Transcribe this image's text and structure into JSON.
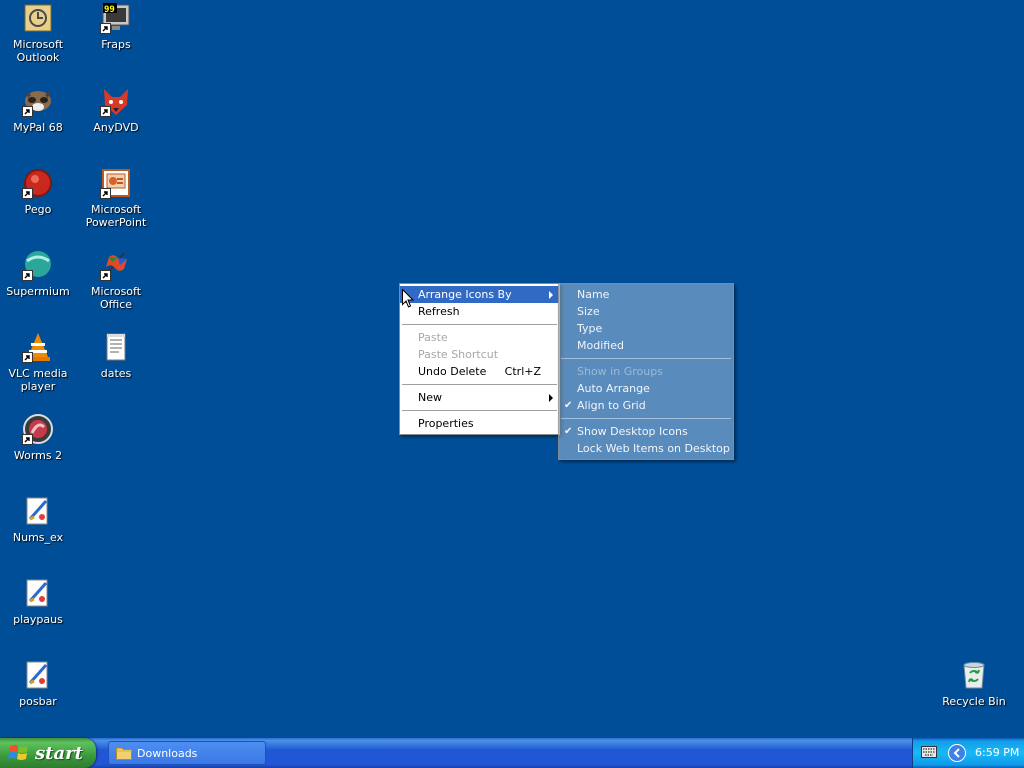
{
  "desktop": {
    "icons": [
      {
        "label": "Microsoft Outlook",
        "icon": "outlook-icon"
      },
      {
        "label": "Fraps",
        "icon": "fraps-icon"
      },
      {
        "label": "MyPal 68",
        "icon": "mypal-icon"
      },
      {
        "label": "AnyDVD",
        "icon": "anydvd-icon"
      },
      {
        "label": "Pego",
        "icon": "pego-icon"
      },
      {
        "label": "Microsoft PowerPoint",
        "icon": "powerpoint-icon"
      },
      {
        "label": "Supermium",
        "icon": "supermium-icon"
      },
      {
        "label": "Microsoft Office",
        "icon": "office-icon"
      },
      {
        "label": "VLC media player",
        "icon": "vlc-icon"
      },
      {
        "label": "dates",
        "icon": "text-file-icon"
      },
      {
        "label": "Worms 2",
        "icon": "worms-icon"
      },
      {
        "label": "Nums_ex",
        "icon": "paint-file-icon"
      },
      {
        "label": "playpaus",
        "icon": "paint-file-icon"
      },
      {
        "label": "posbar",
        "icon": "paint-file-icon"
      },
      {
        "label": "Recycle Bin",
        "icon": "recycle-bin-icon"
      }
    ]
  },
  "context_menu": {
    "items": [
      {
        "label": "Arrange Icons By",
        "submenu": true,
        "highlighted": true
      },
      {
        "label": "Refresh"
      },
      {
        "label": "Paste",
        "disabled": true
      },
      {
        "label": "Paste Shortcut",
        "disabled": true
      },
      {
        "label": "Undo Delete",
        "shortcut": "Ctrl+Z"
      },
      {
        "label": "New",
        "submenu": true
      },
      {
        "label": "Properties"
      }
    ]
  },
  "submenu": {
    "items": [
      {
        "label": "Name"
      },
      {
        "label": "Size"
      },
      {
        "label": "Type"
      },
      {
        "label": "Modified"
      },
      {
        "label": "Show in Groups",
        "disabled": true
      },
      {
        "label": "Auto Arrange"
      },
      {
        "label": "Align to Grid",
        "checked": true
      },
      {
        "label": "Show Desktop Icons",
        "checked": true
      },
      {
        "label": "Lock Web Items on Desktop"
      }
    ]
  },
  "taskbar": {
    "start_label": "start",
    "tasks": [
      {
        "label": "Downloads",
        "icon": "folder-icon"
      }
    ],
    "clock": "6:59 PM"
  },
  "colors": {
    "desktop_bg": "#004e98",
    "highlight": "#316ac5",
    "start_green": "#3a9a3a",
    "taskbar_blue": "#2157d7"
  }
}
